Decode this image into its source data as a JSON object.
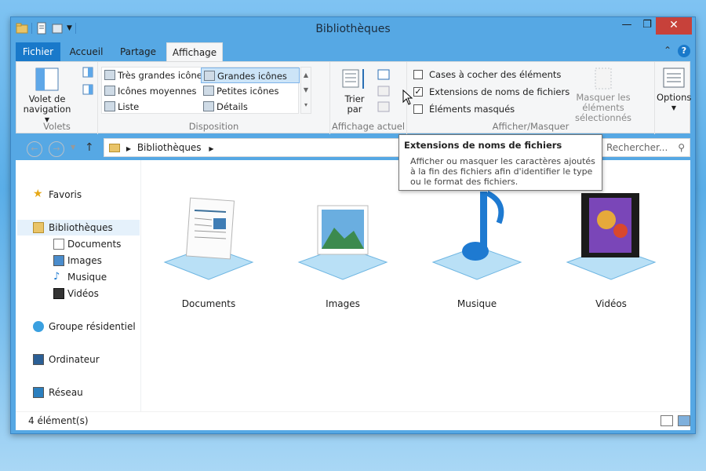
{
  "window": {
    "title": "Bibliothèques"
  },
  "window_buttons": {
    "minimize": "—",
    "maximize": "❐",
    "close": "✕"
  },
  "tabs": {
    "file": "Fichier",
    "home": "Accueil",
    "share": "Partage",
    "view": "Affichage"
  },
  "ribbon": {
    "panes": {
      "nav_pane_label": "Volet de navigation",
      "group": "Volets"
    },
    "layout": {
      "items": [
        "Très grandes icônes",
        "Grandes icônes",
        "Icônes moyennes",
        "Petites icônes",
        "Liste",
        "Détails"
      ],
      "group": "Disposition"
    },
    "current_view": {
      "sort_label": "Trier par",
      "group": "Affichage actuel"
    },
    "show_hide": {
      "checkboxes": [
        "Cases à cocher des éléments",
        "Extensions de noms de fichiers",
        "Éléments masqués"
      ],
      "hide_selected": "Masquer les éléments sélectionnés",
      "group": "Afficher/Masquer"
    },
    "options": "Options"
  },
  "address": {
    "path": "Bibliothèques",
    "search_placeholder": "Rechercher..."
  },
  "nav_pane": {
    "favorites": "Favoris",
    "libraries": "Bibliothèques",
    "library_items": [
      "Documents",
      "Images",
      "Musique",
      "Vidéos"
    ],
    "homegroup": "Groupe résidentiel",
    "computer": "Ordinateur",
    "network": "Réseau"
  },
  "tiles": [
    "Documents",
    "Images",
    "Musique",
    "Vidéos"
  ],
  "tooltip": {
    "title": "Extensions de noms de fichiers",
    "description": "Afficher ou masquer les caractères ajoutés à la fin des fichiers afin d'identifier le type ou le format des fichiers."
  },
  "status": {
    "count": "4 élément(s)"
  },
  "colors": {
    "accent": "#1979ca",
    "frame": "#56a8e4",
    "close": "#c7413a",
    "selection": "#cce4f7"
  }
}
